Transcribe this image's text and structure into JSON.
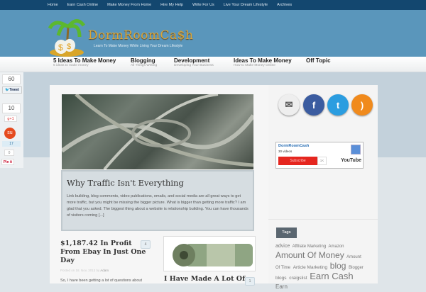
{
  "top_nav": [
    "Home",
    "Earn Cash Online",
    "Make Money From Home",
    "Hire My Help",
    "Write For Us",
    "Live Your Dream Lifestyle",
    "Archives"
  ],
  "logo": {
    "title": "DormRoomCa$h",
    "tagline": "Learn To Make Money While Living Your Dream Lifestyle"
  },
  "categories": [
    {
      "label": "5 Ideas To Make Money",
      "sub": "5 ideas to make money"
    },
    {
      "label": "Blogging",
      "sub": "All Things Writing"
    },
    {
      "label": "Development",
      "sub": "Developing Your Business"
    },
    {
      "label": "Ideas To Make Money",
      "sub": "How to Make Money Online"
    },
    {
      "label": "Off Topic",
      "sub": ""
    }
  ],
  "share": {
    "tweets": "60",
    "tweet_label": "Tweet",
    "gplus_count": "10",
    "gplus_label": "g+1",
    "stumble_count": "17",
    "pin_count": "0",
    "pin_label": "Pin it"
  },
  "featured": {
    "title": "Why Traffic Isn't Everything",
    "excerpt": "Link building, blog comments, video publications, emails, and social media are all great ways to get more traffic, but you might be missing the bigger picture. What is bigger than getting more traffic? I am glad that you asked. The biggest thing about a website is relationship building. You can have thousands of visitors coming [...]"
  },
  "posts": [
    {
      "title": "$1,187.42 In Profit From Ebay In Just One Day",
      "comments": "4",
      "meta_prefix": "Posted on 18. Nov, 2013 by",
      "author": "Adam",
      "excerpt": "So, I have been getting a lot of questions about"
    },
    {
      "title": "I Have Made A Lot Of",
      "comments": "1"
    }
  ],
  "youtube": {
    "channel": "DormRoomCash",
    "videos": "30 videos",
    "subscribe": "Subscribe",
    "count": "1K",
    "logo": "YouTube"
  },
  "tags_title": "Tags",
  "tags": [
    {
      "t": "advice",
      "s": 7
    },
    {
      "t": "Affiliate Marketing",
      "s": 6
    },
    {
      "t": "Amazon",
      "s": 6
    },
    {
      "t": "Amount Of Money",
      "s": 12
    },
    {
      "t": "Amount Of Time",
      "s": 6
    },
    {
      "t": "Article Marketing",
      "s": 6.5
    },
    {
      "t": "blog",
      "s": 12
    },
    {
      "t": "Blogger",
      "s": 6
    },
    {
      "t": "blogs",
      "s": 6.5
    },
    {
      "t": "craigslist",
      "s": 6.5
    },
    {
      "t": "Earn Cash",
      "s": 13
    },
    {
      "t": "Earn",
      "s": 8
    }
  ]
}
